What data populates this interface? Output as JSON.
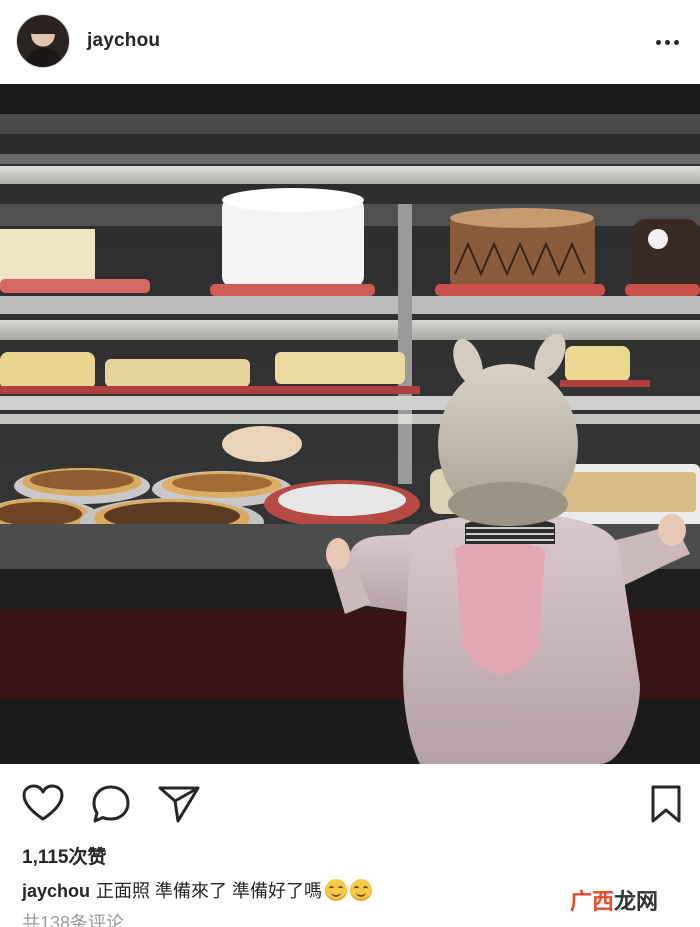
{
  "post": {
    "username": "jaychou",
    "likes_text": "1,115次赞",
    "caption_user": "jaychou",
    "caption_text": "正面照 準備來了 準備好了嗎",
    "caption_emojis": [
      "grinning-squint-emoji",
      "grinning-squint-emoji"
    ],
    "comments_link": "共138条评论"
  },
  "icons": {
    "more": "more-options-icon",
    "like": "heart-icon",
    "comment": "comment-bubble-icon",
    "share": "paper-plane-icon",
    "save": "bookmark-icon"
  },
  "watermark": {
    "part1": "广西",
    "part2": "龙网"
  },
  "colors": {
    "text": "#262626",
    "muted": "#9a9a9a",
    "watermark_accent": "#e8492b"
  }
}
